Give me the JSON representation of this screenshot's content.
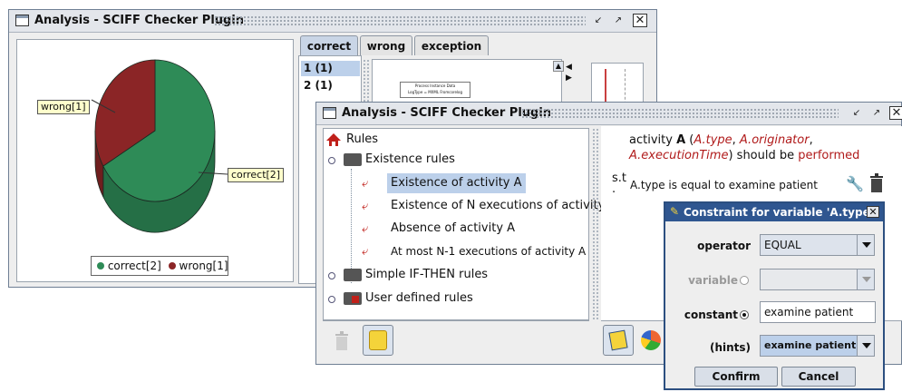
{
  "back_window": {
    "title": "Analysis - SCIFF Checker Plugin",
    "chart_data": {
      "type": "pie",
      "categories": [
        "correct[2]",
        "wrong[1]"
      ],
      "values": [
        2,
        1
      ],
      "colors": [
        "#2e8b57",
        "#8b2526"
      ],
      "callouts": [
        "wrong[1]",
        "correct[2]"
      ],
      "legend": [
        "correct[2]",
        "wrong[1]"
      ]
    },
    "tabs": [
      "correct",
      "wrong",
      "exception"
    ],
    "list_items": [
      "1 (1)",
      "2 (1)"
    ],
    "thumbnail_lines": [
      "Process Instance Data",
      "LogType = MXML Fromcorelog"
    ]
  },
  "front_window": {
    "title": "Analysis - SCIFF Checker Plugin",
    "tree": {
      "root": "Rules",
      "existence_folder": "Existence rules",
      "items": [
        "Existence of activity A",
        "Existence of N executions of activity A",
        "Absence of activity A",
        "At most N-1 executions of activity A"
      ],
      "simple_folder": "Simple IF-THEN rules",
      "user_folder": "User defined rules"
    },
    "rule": {
      "prefix": "activity ",
      "activity": "A",
      "open": " (",
      "attr_type": "A.type",
      "comma1": ", ",
      "attr_originator": "A.originator",
      "comma2": ",",
      "attr_time": "A.executionTime",
      "close": ") should be ",
      "performed": "performed",
      "st": "s.t",
      "st_dot": ".",
      "constraint": "A.type is equal to examine patient"
    }
  },
  "dialog": {
    "title": "Constraint for variable 'A.type'",
    "operator_label": "operator",
    "operator_value": "EQUAL",
    "variable_label": "variable",
    "constant_label": "constant",
    "constant_value": "examine patient",
    "hints_label": "(hints)",
    "hints_value": "examine patient",
    "confirm": "Confirm",
    "cancel": "Cancel"
  }
}
